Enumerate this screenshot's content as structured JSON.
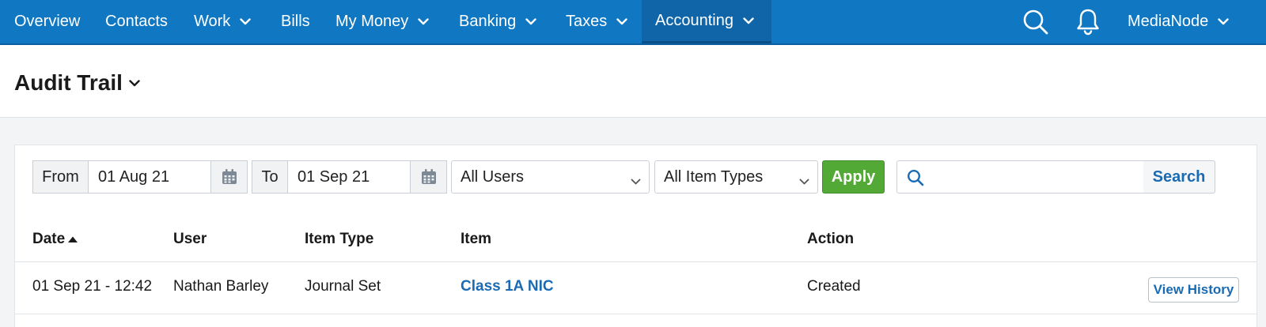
{
  "nav": {
    "items": [
      {
        "label": "Overview"
      },
      {
        "label": "Contacts"
      },
      {
        "label": "Work"
      },
      {
        "label": "Bills"
      },
      {
        "label": "My Money"
      },
      {
        "label": "Banking"
      },
      {
        "label": "Taxes"
      },
      {
        "label": "Accounting",
        "active": true
      }
    ],
    "account_label": "MediaNode",
    "icons": [
      "search-icon",
      "bell-icon"
    ]
  },
  "header": {
    "title": "Audit Trail"
  },
  "filters": {
    "from_label": "From",
    "from_value": "01 Aug 21",
    "to_label": "To",
    "to_value": "01 Sep 21",
    "users_select": "All Users",
    "item_types_select": "All Item Types",
    "apply_label": "Apply",
    "search_placeholder": "",
    "search_label": "Search"
  },
  "table": {
    "columns": [
      "Date",
      "User",
      "Item Type",
      "Item",
      "Action"
    ],
    "sort_column": "Date",
    "sort_direction": "ascending",
    "rows": [
      {
        "date": "01 Sep 21 - 12:42",
        "user": "Nathan Barley",
        "item_type": "Journal Set",
        "item": "Class 1A NIC",
        "action": "Created",
        "button": "View History"
      }
    ]
  },
  "colors": {
    "nav_bg": "#1077c3",
    "nav_active": "#0f65a8",
    "apply_green": "#52a935",
    "link_blue": "#1a6bb3",
    "page_bg": "#f2f4f5"
  }
}
